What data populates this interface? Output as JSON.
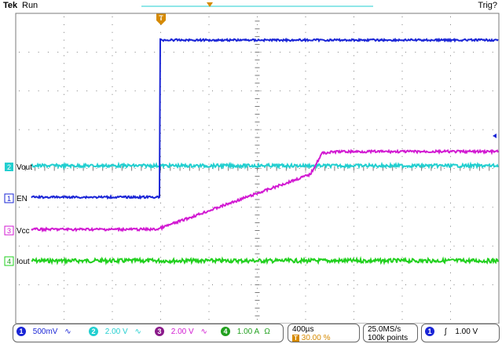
{
  "header": {
    "brand": "Tek",
    "status": "Run",
    "trigger_status": "Trig?"
  },
  "colors": {
    "ch1": "#1a25d6",
    "ch2": "#22cfd0",
    "ch3": "#d21ad2",
    "ch4": "#22d01f",
    "grid": "#7a7a7a",
    "accent": "#d68a00"
  },
  "channels": [
    {
      "num": "1",
      "label": "EN",
      "scale": "500mV",
      "coupling_icon": "bw-limit-icon"
    },
    {
      "num": "2",
      "label": "Vout",
      "scale": "2.00 V",
      "coupling_icon": "bw-limit-icon"
    },
    {
      "num": "3",
      "label": "Vcc",
      "scale": "2.00 V",
      "coupling_icon": "bw-limit-icon"
    },
    {
      "num": "4",
      "label": "Iout",
      "scale": "1.00 A",
      "unit_icon": "ohm-icon",
      "unit_glyph": "Ω"
    }
  ],
  "markers": {
    "trigger_position": "T",
    "ch1_level": "1"
  },
  "bottom": {
    "bw_glyph": "∿",
    "timebase": "400µs",
    "trigger_offset_icon": "T",
    "trigger_offset": "30.00 %",
    "sample_rate": "25.0MS/s",
    "record_length": "100k points",
    "trigger_source": "1",
    "trigger_slope_icon": "rising-edge-icon",
    "trigger_slope_glyph": "∫",
    "trigger_level": "1.00 V"
  }
}
